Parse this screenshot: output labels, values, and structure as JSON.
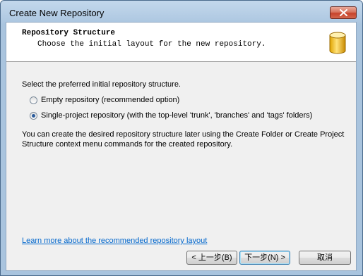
{
  "window": {
    "title": "Create New Repository"
  },
  "header": {
    "title": "Repository Structure",
    "subtitle": "Choose the initial layout for the new repository."
  },
  "body": {
    "prompt": "Select the preferred initial repository structure.",
    "options": [
      {
        "label": "Empty repository (recommended option)",
        "checked": false
      },
      {
        "label": "Single-project repository (with the top-level 'trunk', 'branches' and 'tags' folders)",
        "checked": true
      }
    ],
    "info": "You can create the desired repository structure later using the Create Folder or Create Project Structure context menu commands for the created repository.",
    "link": "Learn more about the recommended repository layout"
  },
  "buttons": {
    "back": "< 上一步(B)",
    "next": "下一步(N) >",
    "cancel": "取消"
  }
}
